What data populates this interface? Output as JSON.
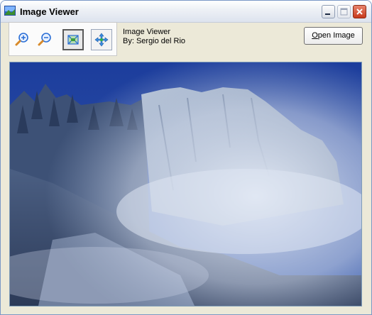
{
  "window": {
    "title": "Image Viewer"
  },
  "title_buttons": {
    "minimize": "minimize-icon",
    "maximize": "maximize-icon",
    "close": "close-icon"
  },
  "toolbar": {
    "zoom_in_icon": "zoom-in-icon",
    "zoom_out_icon": "zoom-out-icon",
    "fit_icon": "fit-to-window-icon",
    "pan_icon": "pan-move-icon"
  },
  "info": {
    "line1": "Image Viewer",
    "line2": "By: Sergio del Rio"
  },
  "open_button": {
    "accesskey": "O",
    "rest": "pen Image"
  },
  "image": {
    "subject": "misty mountain cliff under blue sky"
  },
  "colors": {
    "sky": "#1f3f9a",
    "title_close": "#c7391c",
    "window_border": "#7a98c6"
  }
}
